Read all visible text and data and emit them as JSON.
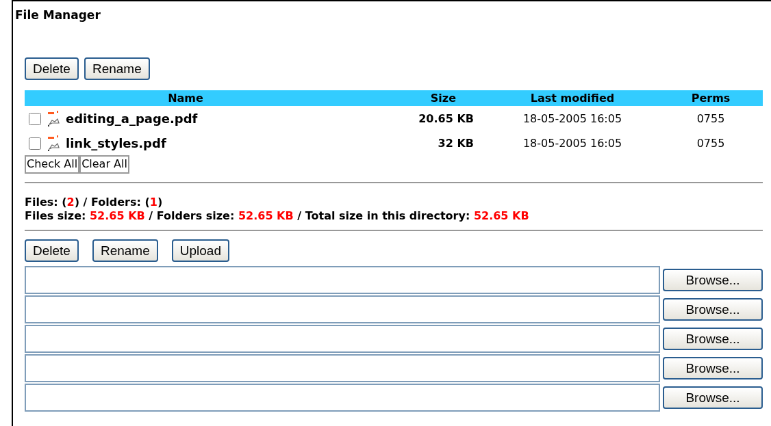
{
  "title": "File Manager",
  "top_buttons": [
    "Delete",
    "Rename"
  ],
  "table": {
    "columns": [
      "Name",
      "Size",
      "Last modified",
      "Perms"
    ],
    "rows": [
      {
        "checked": false,
        "name": "editing_a_page.pdf",
        "size": "20.65 KB",
        "modified": "18-05-2005 16:05",
        "perms": "0755"
      },
      {
        "checked": false,
        "name": "link_styles.pdf",
        "size": "32 KB",
        "modified": "18-05-2005 16:05",
        "perms": "0755"
      }
    ]
  },
  "select_buttons": [
    "Check All",
    "Clear All"
  ],
  "summary": [
    [
      {
        "kind": "label",
        "text": "Files: ("
      },
      {
        "kind": "value",
        "text": "2"
      },
      {
        "kind": "label",
        "text": ") / Folders: ("
      },
      {
        "kind": "value",
        "text": "1"
      },
      {
        "kind": "label",
        "text": ")"
      }
    ],
    [
      {
        "kind": "label",
        "text": "Files size: "
      },
      {
        "kind": "value",
        "text": "52.65 KB"
      },
      {
        "kind": "label",
        "text": " / Folders size: "
      },
      {
        "kind": "value",
        "text": "52.65 KB"
      },
      {
        "kind": "label",
        "text": " / Total size in this directory: "
      },
      {
        "kind": "value",
        "text": "52.65 KB"
      }
    ]
  ],
  "bottom_buttons": [
    "Delete",
    "Rename",
    "Upload"
  ],
  "upload_rows": [
    {
      "browse": "Browse..."
    },
    {
      "browse": "Browse..."
    },
    {
      "browse": "Browse..."
    },
    {
      "browse": "Browse..."
    },
    {
      "browse": "Browse..."
    }
  ]
}
